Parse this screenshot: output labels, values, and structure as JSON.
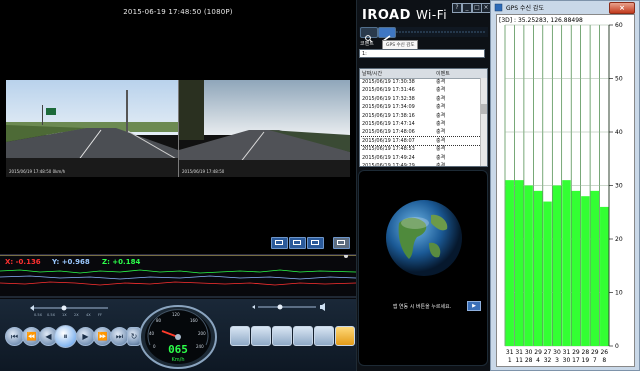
{
  "player": {
    "datetime": "2015-06-19 17:48:50 (1080P)",
    "video_overlay_front": "2015/06/19 17:48:50 0km/h",
    "video_overlay_rear": "2015/06/19 17:48:50"
  },
  "gsensor": {
    "x": "X: -0.136",
    "y": "Y: +0.968",
    "z": "Z: +0.184"
  },
  "speed_labels": [
    "0.5X",
    "0.5X",
    "1X",
    "2X",
    "4X",
    "FF"
  ],
  "speedometer": {
    "value": "065",
    "unit": "Km/h",
    "ticks": [
      "0",
      "40",
      "80",
      "120",
      "160",
      "200",
      "240"
    ]
  },
  "app": {
    "brand": "IROAD",
    "brand_suffix": "Wi-Fi"
  },
  "window_buttons": [
    "?",
    "_",
    "□",
    "×"
  ],
  "comment": {
    "label": "코멘트",
    "tooltip": "GPS 수신 감도",
    "value": "1:"
  },
  "events": {
    "header_date": "날짜/시간",
    "header_type": "이벤트",
    "rows": [
      {
        "dt": "2015/06/19 17:30:38",
        "type": "충격"
      },
      {
        "dt": "2015/06/19 17:31:46",
        "type": "충격"
      },
      {
        "dt": "2015/06/19 17:32:38",
        "type": "충격"
      },
      {
        "dt": "2015/06/19 17:34:09",
        "type": "충격"
      },
      {
        "dt": "2015/06/19 17:38:16",
        "type": "충격"
      },
      {
        "dt": "2015/06/19 17:47:14",
        "type": "충격"
      },
      {
        "dt": "2015/06/19 17:48:06",
        "type": "충격"
      },
      {
        "dt": "2015/06/19 17:48:07",
        "type": "충격"
      },
      {
        "dt": "2015/06/19 17:48:53",
        "type": "충격"
      },
      {
        "dt": "2015/06/19 17:49:24",
        "type": "충격"
      },
      {
        "dt": "2015/06/19 17:49:29",
        "type": "충격"
      }
    ],
    "selected_index": 7
  },
  "globe": {
    "hint": "앱 연동 시 버튼을 누르세요.",
    "next": "▶"
  },
  "gps": {
    "title": "GPS 수신 감도",
    "close": "×",
    "coords": "[3D] : 35.25283, 126.88498",
    "chart_data": {
      "type": "bar",
      "categories": [
        "1",
        "11",
        "28",
        "4",
        "32",
        "3",
        "30",
        "17",
        "19",
        "7",
        "8"
      ],
      "values": [
        31,
        31,
        30,
        29,
        27,
        30,
        31,
        29,
        28,
        29,
        26
      ],
      "bar_value_labels": [
        "31",
        "31",
        "30",
        "29",
        "27",
        "30",
        "31",
        "29",
        "28",
        "29",
        "26"
      ],
      "ylim": [
        0,
        60
      ],
      "yticks": [
        0,
        10,
        20,
        30,
        40,
        50,
        60
      ],
      "grid": true,
      "bar_color": "#33ff33"
    }
  }
}
